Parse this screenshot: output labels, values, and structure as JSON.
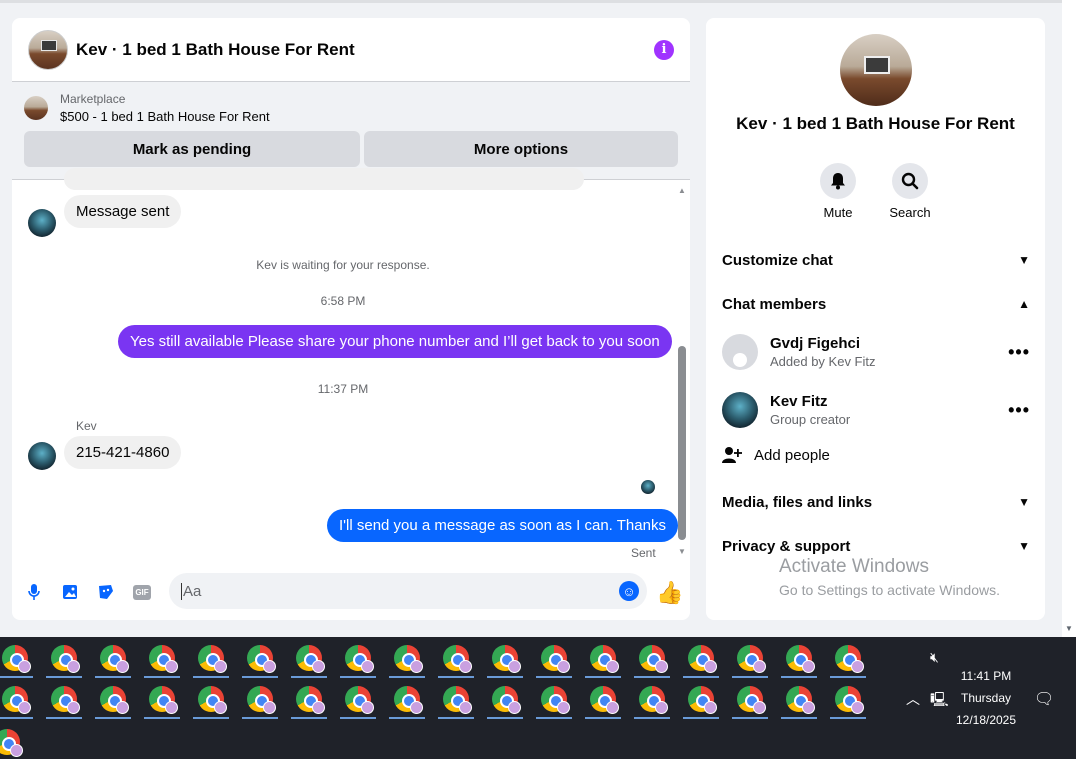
{
  "chat": {
    "title": "Kev · 1 bed 1 Bath House For Rent",
    "info_icon": "i",
    "marketplace": {
      "label": "Marketplace",
      "listing": "$500 - 1 bed 1 Bath House For Rent",
      "pending_button": "Mark as pending",
      "more_button": "More options"
    },
    "messages": {
      "message_sent": "Message sent",
      "waiting": "Kev is waiting for your response.",
      "time1": "6:58 PM",
      "out1": "Yes still available Please share your phone number and I’ll get back to you soon",
      "time2": "11:37 PM",
      "sender": "Kev",
      "in_phone": "215-421-4860",
      "out2": "I'll send you a message as soon as I can. Thanks",
      "sent_status": "Sent"
    },
    "composer": {
      "placeholder": "Aa",
      "gif": "GIF"
    },
    "colors": {
      "out1": "#7a35f2",
      "out2": "#0866ff"
    }
  },
  "details": {
    "title": "Kev · 1 bed 1 Bath House For Rent",
    "mute_label": "Mute",
    "search_label": "Search",
    "customize_chat": "Customize chat",
    "chat_members": "Chat members",
    "members": [
      {
        "name": "Gvdj Figehci",
        "sub": "Added by Kev Fitz"
      },
      {
        "name": "Kev Fitz",
        "sub": "Group creator"
      }
    ],
    "add_people": "Add people",
    "media": "Media, files and links",
    "privacy": "Privacy & support"
  },
  "watermark": {
    "line1": "Activate Windows",
    "line2": "Go to Settings to activate Windows."
  },
  "taskbar": {
    "time": "11:41 PM",
    "day": "Thursday",
    "date": "12/18/2025"
  }
}
